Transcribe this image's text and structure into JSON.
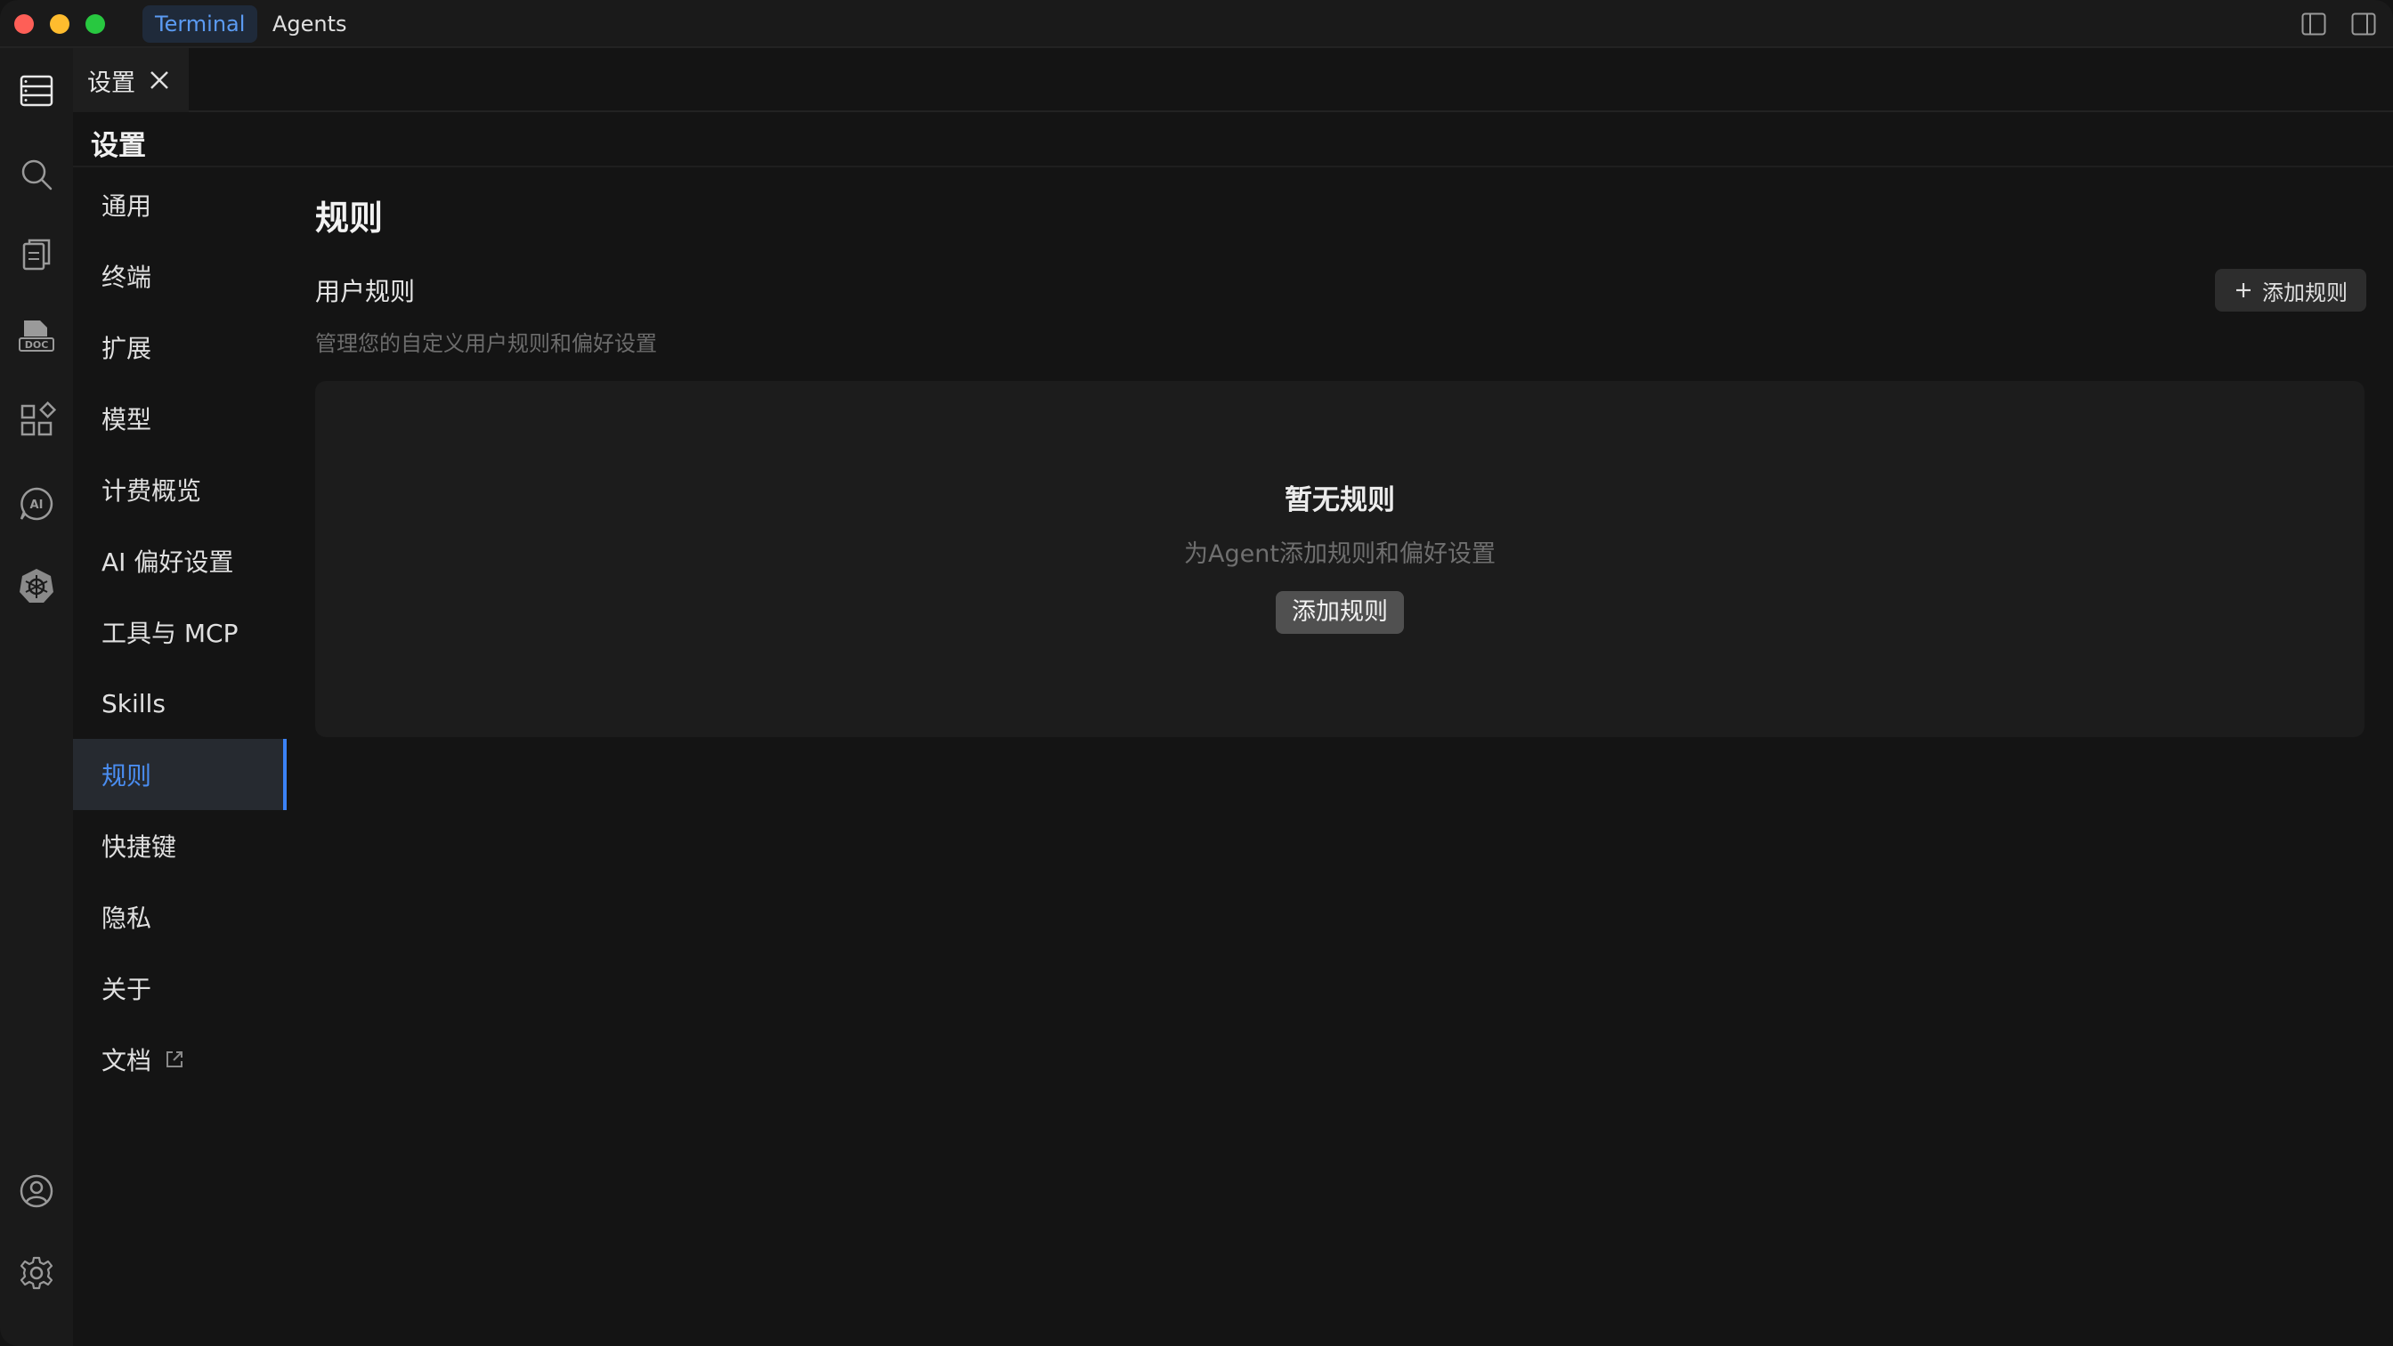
{
  "titlebar": {
    "tabs": [
      {
        "label": "Terminal",
        "active": true
      },
      {
        "label": "Agents",
        "active": false
      }
    ]
  },
  "activitybar": {
    "top_icons": [
      "explorer-icon",
      "search-icon",
      "clipboard-icon",
      "doc-icon",
      "extensions-icon",
      "ai-icon",
      "kubernetes-icon"
    ],
    "bottom_icons": [
      "account-icon",
      "settings-gear-icon"
    ]
  },
  "editor_tab": {
    "label": "设置"
  },
  "settings": {
    "title": "设置",
    "nav": [
      {
        "label": "通用"
      },
      {
        "label": "终端"
      },
      {
        "label": "扩展"
      },
      {
        "label": "模型"
      },
      {
        "label": "计费概览"
      },
      {
        "label": "AI 偏好设置"
      },
      {
        "label": "工具与 MCP"
      },
      {
        "label": "Skills"
      },
      {
        "label": "规则",
        "active": true
      },
      {
        "label": "快捷键"
      },
      {
        "label": "隐私"
      },
      {
        "label": "关于"
      },
      {
        "label": "文档",
        "external": true
      }
    ]
  },
  "main": {
    "heading": "规则",
    "section_title": "用户规则",
    "section_desc": "管理您的自定义用户规则和偏好设置",
    "add_button_label": "添加规则",
    "empty": {
      "title": "暂无规则",
      "desc": "为Agent添加规则和偏好设置",
      "button_label": "添加规则"
    }
  },
  "colors": {
    "accent": "#3b82f6",
    "background": "#141414",
    "sidebar": "#1a1a1a"
  }
}
